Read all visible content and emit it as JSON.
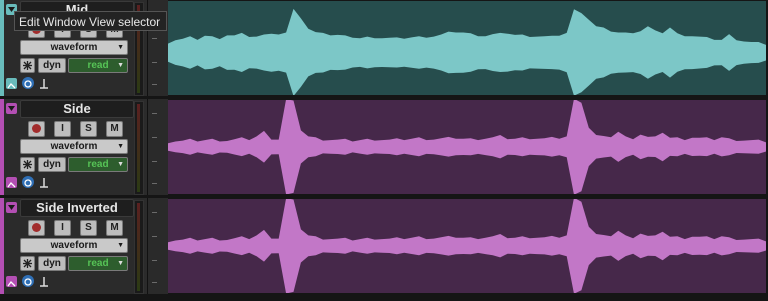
{
  "tracks": [
    {
      "name": "Mid",
      "color": "#69bcbc",
      "lane_bg": "#264d4d",
      "wave_color": "#7cc7c7",
      "view": "waveform",
      "dyn": "dyn",
      "automation": "read",
      "buttons": {
        "input": "I",
        "solo": "S",
        "mute": "M"
      },
      "wave": [
        0.22,
        0.28,
        0.3,
        0.34,
        0.3,
        0.38,
        0.35,
        0.33,
        0.4,
        0.38,
        0.42,
        0.37,
        0.36,
        0.39,
        0.46,
        0.42,
        0.45,
        1.0,
        0.82,
        0.55,
        0.45,
        0.48,
        0.4,
        0.39,
        0.36,
        0.35,
        0.32,
        0.34,
        0.35,
        0.33,
        0.32,
        0.31,
        0.33,
        0.34,
        0.35,
        0.36,
        0.37,
        0.4,
        0.45,
        0.48,
        0.46,
        0.42,
        0.4,
        0.38,
        0.41,
        0.42,
        0.45,
        0.4,
        0.39,
        0.38,
        0.37,
        0.36,
        0.35,
        0.4,
        0.45,
        1.0,
        0.96,
        0.78,
        0.6,
        0.55,
        0.5,
        0.46,
        0.44,
        0.47,
        0.5,
        0.6,
        0.48,
        0.46,
        0.58,
        0.42,
        0.4,
        0.38,
        0.35,
        0.32,
        0.3,
        0.28,
        0.4,
        0.3,
        0.25,
        0.22,
        0.2,
        0.18
      ]
    },
    {
      "name": "Side",
      "color": "#b34fb3",
      "lane_bg": "#46284a",
      "wave_color": "#c277c7",
      "view": "waveform",
      "dyn": "dyn",
      "automation": "read",
      "buttons": {
        "input": "I",
        "solo": "S",
        "mute": "M"
      },
      "wave": [
        0.08,
        0.1,
        0.1,
        0.12,
        0.11,
        0.12,
        0.13,
        0.12,
        0.11,
        0.13,
        0.15,
        0.14,
        0.2,
        0.3,
        0.16,
        0.14,
        1.0,
        0.95,
        0.35,
        0.2,
        0.16,
        0.14,
        0.13,
        0.12,
        0.12,
        0.11,
        0.12,
        0.13,
        0.14,
        0.13,
        0.12,
        0.13,
        0.14,
        0.15,
        0.16,
        0.15,
        0.14,
        0.15,
        0.16,
        0.17,
        0.15,
        0.14,
        0.15,
        0.16,
        0.17,
        0.2,
        0.16,
        0.15,
        0.16,
        0.17,
        0.16,
        0.15,
        0.16,
        0.17,
        0.2,
        1.0,
        0.96,
        0.4,
        0.22,
        0.18,
        0.2,
        0.3,
        0.18,
        0.17,
        0.25,
        0.18,
        0.17,
        0.3,
        0.17,
        0.16,
        0.15,
        0.18,
        0.16,
        0.15,
        0.14,
        0.18,
        0.14,
        0.13,
        0.12,
        0.11,
        0.1,
        0.09
      ]
    },
    {
      "name": "Side Inverted",
      "color": "#b34fb3",
      "lane_bg": "#46284a",
      "wave_color": "#c277c7",
      "view": "waveform",
      "dyn": "dyn",
      "automation": "read",
      "buttons": {
        "input": "I",
        "solo": "S",
        "mute": "M"
      },
      "wave": [
        0.08,
        0.1,
        0.1,
        0.12,
        0.11,
        0.12,
        0.13,
        0.12,
        0.11,
        0.13,
        0.15,
        0.14,
        0.2,
        0.3,
        0.16,
        0.14,
        1.0,
        0.95,
        0.35,
        0.2,
        0.16,
        0.14,
        0.13,
        0.12,
        0.12,
        0.11,
        0.12,
        0.13,
        0.14,
        0.13,
        0.12,
        0.13,
        0.14,
        0.15,
        0.16,
        0.15,
        0.14,
        0.15,
        0.16,
        0.17,
        0.15,
        0.14,
        0.15,
        0.16,
        0.17,
        0.2,
        0.16,
        0.15,
        0.16,
        0.17,
        0.16,
        0.15,
        0.16,
        0.17,
        0.2,
        1.0,
        0.96,
        0.4,
        0.22,
        0.18,
        0.2,
        0.3,
        0.18,
        0.17,
        0.25,
        0.18,
        0.17,
        0.3,
        0.17,
        0.16,
        0.15,
        0.18,
        0.16,
        0.15,
        0.14,
        0.18,
        0.14,
        0.13,
        0.12,
        0.11,
        0.1,
        0.09
      ]
    }
  ],
  "tooltip": "Edit Window View selector"
}
